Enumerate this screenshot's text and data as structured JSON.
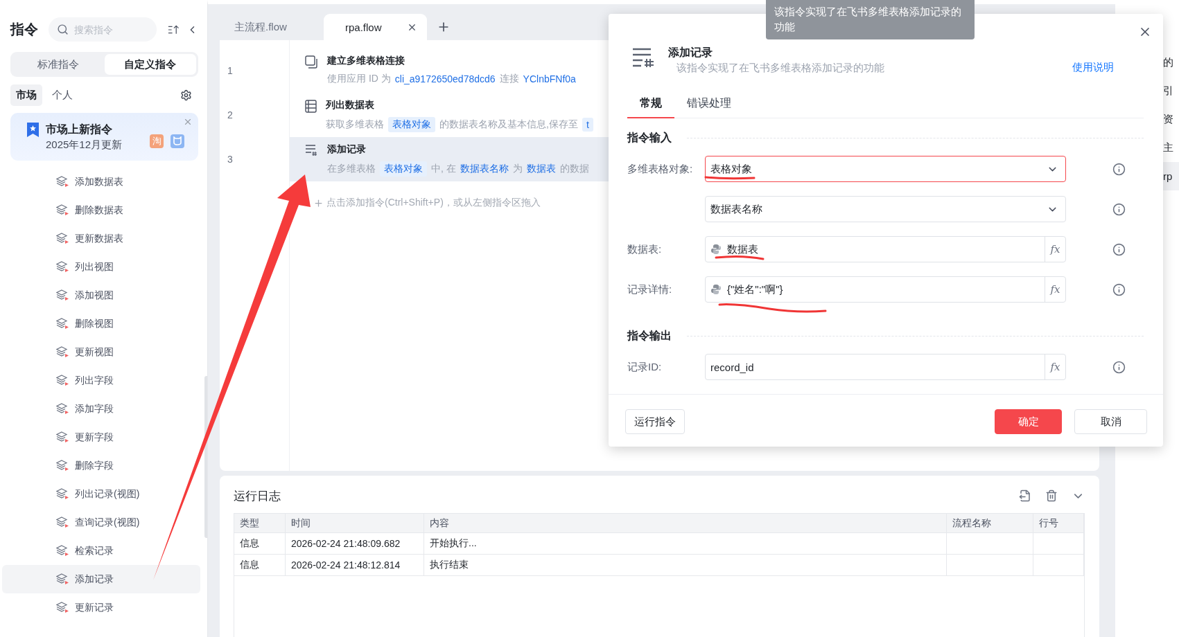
{
  "sidebar": {
    "title": "指令",
    "search": {
      "placeholder": "搜索指令"
    },
    "segments": [
      {
        "label": "标准指令",
        "selected": false
      },
      {
        "label": "自定义指令",
        "selected": true
      }
    ],
    "filters": [
      {
        "label": "市场",
        "selected": true
      },
      {
        "label": "个人",
        "selected": false
      }
    ],
    "banner": {
      "title": "市场上新指令",
      "subtitle": "2025年12月更新",
      "badges": [
        {
          "kind": "text",
          "label": "淘",
          "color": "#f4a27a"
        },
        {
          "kind": "icon",
          "color": "#8db6f3"
        }
      ]
    },
    "items": [
      {
        "label": "添加数据表",
        "selected": false
      },
      {
        "label": "删除数据表",
        "selected": false
      },
      {
        "label": "更新数据表",
        "selected": false
      },
      {
        "label": "列出视图",
        "selected": false
      },
      {
        "label": "添加视图",
        "selected": false
      },
      {
        "label": "删除视图",
        "selected": false
      },
      {
        "label": "更新视图",
        "selected": false
      },
      {
        "label": "列出字段",
        "selected": false
      },
      {
        "label": "添加字段",
        "selected": false
      },
      {
        "label": "更新字段",
        "selected": false
      },
      {
        "label": "删除字段",
        "selected": false
      },
      {
        "label": "列出记录(视图)",
        "selected": false
      },
      {
        "label": "查询记录(视图)",
        "selected": false
      },
      {
        "label": "检索记录",
        "selected": false
      },
      {
        "label": "添加记录",
        "selected": true
      },
      {
        "label": "更新记录",
        "selected": false
      }
    ]
  },
  "tabs": [
    {
      "label": "主流程.flow",
      "selected": false
    },
    {
      "label": "rpa.flow",
      "selected": true
    }
  ],
  "flow": {
    "rows": [
      {
        "number": "1",
        "kind": "connect",
        "title": "建立多维表格连接",
        "selected": false,
        "description": [
          {
            "kind": "text",
            "text": "使用应用 ID 为"
          },
          {
            "kind": "link",
            "text": "cli_a9172650ed78dcd6"
          },
          {
            "kind": "text",
            "text": "连接"
          },
          {
            "kind": "link",
            "text": "YClnbFNf0a"
          }
        ]
      },
      {
        "number": "2",
        "kind": "list",
        "title": "列出数据表",
        "selected": false,
        "description": [
          {
            "kind": "text",
            "text": "获取多维表格"
          },
          {
            "kind": "chip",
            "text": "表格对象"
          },
          {
            "kind": "text",
            "text": "的数据表名称及基本信息,保存至"
          },
          {
            "kind": "chip",
            "text": "t"
          }
        ]
      },
      {
        "number": "3",
        "kind": "add",
        "title": "添加记录",
        "selected": true,
        "description": [
          {
            "kind": "text",
            "text": "在多维表格"
          },
          {
            "kind": "chip",
            "text": "表格对象"
          },
          {
            "kind": "text",
            "text": "中, 在"
          },
          {
            "kind": "link",
            "text": "数据表名称"
          },
          {
            "kind": "text",
            "text": "为"
          },
          {
            "kind": "link",
            "text": "数据表"
          },
          {
            "kind": "text",
            "text": "的数据"
          }
        ]
      }
    ],
    "hint": "点击添加指令(Ctrl+Shift+P)，或从左侧指令区拖入"
  },
  "log": {
    "title": "运行日志",
    "columns": [
      "类型",
      "时间",
      "内容",
      "流程名称",
      "行号"
    ],
    "rows": [
      {
        "cells": [
          "信息",
          "2026-02-24 21:48:09.682",
          "开始执行..."
        ]
      },
      {
        "cells": [
          "信息",
          "2026-02-24 21:48:12.814",
          "执行结束"
        ]
      }
    ]
  },
  "right_panel": {
    "items": [
      {
        "label": "的",
        "selected": false
      },
      {
        "label": "引",
        "selected": false
      },
      {
        "label": "资",
        "selected": false
      },
      {
        "label": "主",
        "selected": false
      },
      {
        "label": "rp",
        "selected": true
      }
    ]
  },
  "dialog": {
    "title": "添加记录",
    "description": "该指令实现了在飞书多维表格添加记录的功能",
    "help_link": "使用说明",
    "tabs": [
      {
        "label": "常规",
        "selected": true
      },
      {
        "label": "错误处理",
        "selected": false
      }
    ],
    "sections": [
      {
        "title": "指令输入",
        "fields": [
          {
            "label": "多维表格对象:",
            "kind": "select",
            "value": "表格对象",
            "error": true
          },
          {
            "kind": "select",
            "value": "数据表名称",
            "error": false
          },
          {
            "label": "数据表:",
            "kind": "expression",
            "value": "数据表",
            "error": false,
            "button": "fx"
          },
          {
            "label": "记录详情:",
            "kind": "expression",
            "value": "{\"姓名\":\"啊\"}",
            "error": false,
            "button": "fx"
          }
        ]
      },
      {
        "title": "指令输出",
        "fields": [
          {
            "label": "记录ID:",
            "kind": "text",
            "value": "record_id",
            "error": false,
            "button": "fx"
          }
        ]
      }
    ],
    "buttons": [
      {
        "label": "运行指令",
        "kind": "default"
      },
      {
        "label": "确定",
        "kind": "primary"
      },
      {
        "label": "取消",
        "kind": "default"
      }
    ]
  },
  "tooltip": {
    "text": "该指令实现了在飞书多维表格添加记录的功能"
  }
}
